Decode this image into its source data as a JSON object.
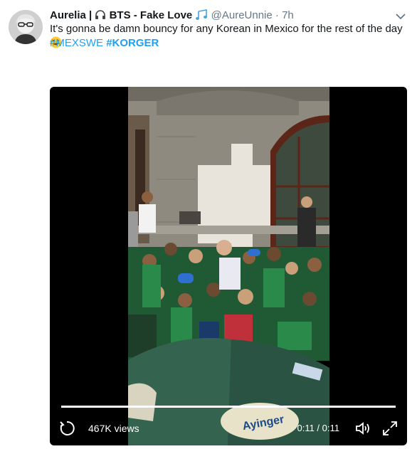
{
  "tweet": {
    "display_name": "Aurelia",
    "name_separator": "|",
    "name_suffix": "BTS - Fake Love",
    "handle": "@AureUnnie",
    "dot": "·",
    "time": "7h",
    "text": "It's gonna be damn bouncy for any Korean in Mexico for the rest of the day",
    "emoji": "face-with-tears-of-joy",
    "hashtags": [
      "#MEXSWE",
      "#KORGER"
    ]
  },
  "video": {
    "views": "467K views",
    "timecode": "0:11 / 0:11",
    "progress": 1.0,
    "sign_text": "Ayinger"
  },
  "colors": {
    "link": "#1da1f2",
    "secondary": "#657786",
    "player_bg": "#000000"
  }
}
